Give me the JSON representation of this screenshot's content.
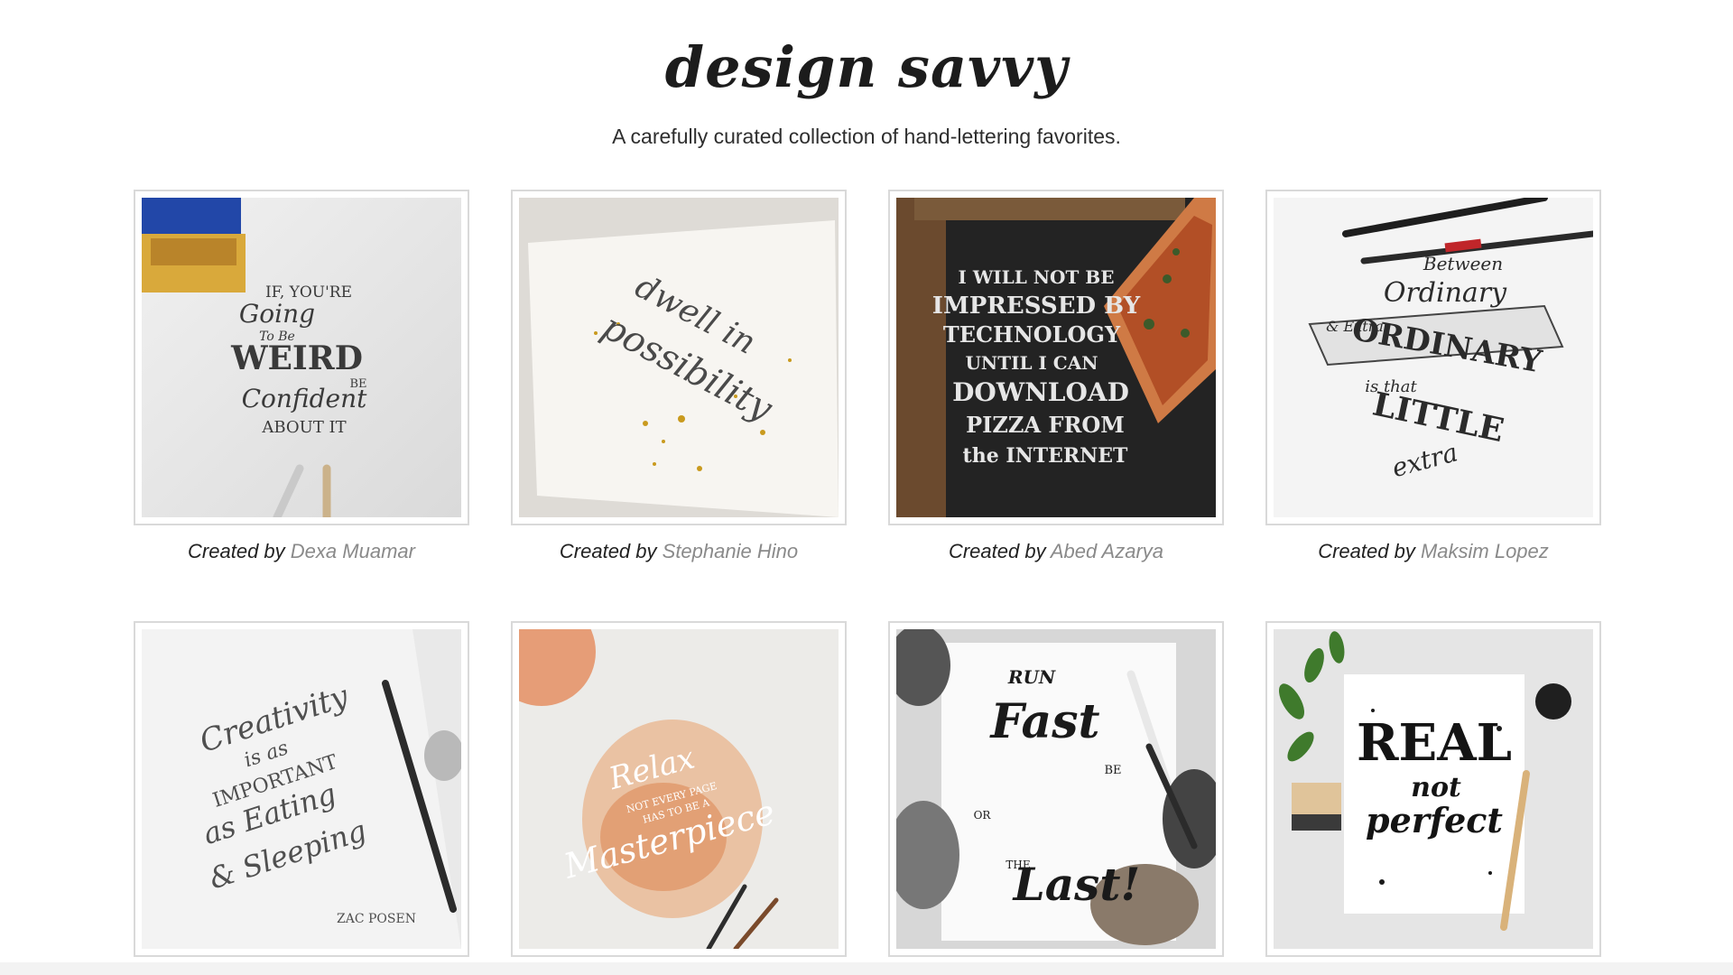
{
  "header": {
    "title": "design savvy",
    "subtitle": "A carefully curated collection of hand-lettering favorites."
  },
  "caption_prefix": "Created by",
  "gallery": [
    {
      "author": "Dexa Muamar",
      "art_lines": [
        "IF, YOU'RE",
        "Going",
        "To Be",
        "WEIRD",
        "BE",
        "Confident",
        "ABOUT IT"
      ]
    },
    {
      "author": "Stephanie Hino",
      "art_lines": [
        "dwell in",
        "possibility"
      ]
    },
    {
      "author": "Abed Azarya",
      "art_lines": [
        "I WILL NOT BE",
        "IMPRESSED BY",
        "TECHNOLOGY",
        "UNTIL I CAN",
        "DOWNLOAD",
        "PIZZA FROM",
        "the INTERNET"
      ]
    },
    {
      "author": "Maksim Lopez",
      "art_lines": [
        "Between",
        "Ordinary",
        "& Extra",
        "ORDINARY",
        "is that",
        "LITTLE",
        "extra"
      ]
    },
    {
      "author": "",
      "art_lines": [
        "Creativity",
        "is as",
        "IMPORTANT",
        "as Eating",
        "& Sleeping",
        "ZAC POSEN"
      ]
    },
    {
      "author": "",
      "art_lines": [
        "Relax",
        "NOT EVERY PAGE",
        "HAS TO BE A",
        "Masterpiece"
      ]
    },
    {
      "author": "",
      "art_lines": [
        "RUN",
        "Fast",
        "BE",
        "OR",
        "THE",
        "Last!"
      ]
    },
    {
      "author": "",
      "art_lines": [
        "REAL",
        "not",
        "perfect"
      ]
    }
  ],
  "colors": {
    "frame_border": "#d9d9d9",
    "author_link": "#8a8a8a",
    "caption_text": "#222222"
  }
}
